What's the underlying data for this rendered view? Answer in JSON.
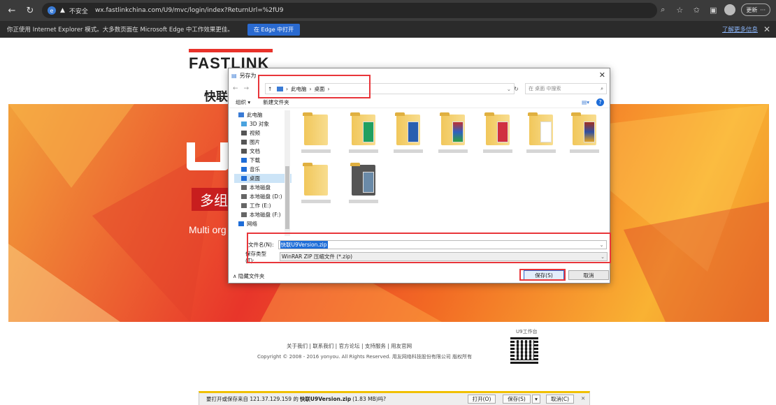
{
  "browser": {
    "url_security": "不安全",
    "url": "wx.fastlinkchina.com/U9/mvc/login/index?ReturnUrl=%2fU9",
    "update_label": "更新",
    "ie_banner": {
      "message": "你正使用 Internet Explorer 模式。大多数页面在 Microsoft Edge 中工作效果更佳。",
      "button": "在 Edge 中打开",
      "learn_more": "了解更多信息",
      "close": "✕"
    }
  },
  "page": {
    "logo_text": "FASTLINK",
    "brand_cn": "快联",
    "hero_cn": "多组",
    "hero_en": "Multi org",
    "footer_links": "关于我们 | 联系我们 | 官方论坛 | 支持服务 | 用友官网",
    "copyright": "Copyright © 2008 - 2016 yonyou.  All Rights Reserved.  用友网络科技股份有限公司  版权所有",
    "qr_label": "U9工作台"
  },
  "dialog": {
    "title": "另存为",
    "close": "✕",
    "path": [
      "此电脑",
      "桌面"
    ],
    "search_placeholder": "在 桌面 中搜索",
    "organize": "组织 ▾",
    "new_folder": "新建文件夹",
    "sidebar": [
      {
        "label": "此电脑",
        "icon": "pc-icon",
        "color": "#3a7bd5",
        "sub": false
      },
      {
        "label": "3D 对象",
        "icon": "3d-objects-icon",
        "color": "#4aa3df",
        "sub": true
      },
      {
        "label": "视频",
        "icon": "video-icon",
        "color": "#555555",
        "sub": true
      },
      {
        "label": "图片",
        "icon": "pictures-icon",
        "color": "#555555",
        "sub": true
      },
      {
        "label": "文档",
        "icon": "documents-icon",
        "color": "#555555",
        "sub": true
      },
      {
        "label": "下载",
        "icon": "download-icon",
        "color": "#1e6dd8",
        "sub": true
      },
      {
        "label": "音乐",
        "icon": "music-icon",
        "color": "#1e6dd8",
        "sub": true
      },
      {
        "label": "桌面",
        "icon": "desktop-icon",
        "color": "#1e6dd8",
        "sub": true,
        "selected": true
      },
      {
        "label": "本地磁盘",
        "icon": "drive-icon",
        "color": "#666666",
        "sub": true
      },
      {
        "label": "本地磁盘 (D:)",
        "icon": "drive-icon",
        "color": "#666666",
        "sub": true
      },
      {
        "label": "工作 (E:)",
        "icon": "drive-icon",
        "color": "#666666",
        "sub": true
      },
      {
        "label": "本地磁盘 (F:)",
        "icon": "drive-icon",
        "color": "#666666",
        "sub": true
      },
      {
        "label": "网络",
        "icon": "network-icon",
        "color": "#1e6dd8",
        "sub": false
      }
    ],
    "filename_label": "文件名(N):",
    "filename_value": "快联U9Version.zip",
    "filetype_label": "保存类型(T):",
    "filetype_value": "WinRAR ZIP 压缩文件 (*.zip)",
    "hide_folders": "隐藏文件夹",
    "save": "保存(S)",
    "cancel": "取消"
  },
  "download_bar": {
    "prefix": "要打开或保存来自 121.37.129.159 的",
    "file": "快联U9Version.zip",
    "size": "(1.83 MB)吗?",
    "open": "打开(O)",
    "save": "保存(S)",
    "cancel": "取消(C)",
    "close": "✕"
  }
}
